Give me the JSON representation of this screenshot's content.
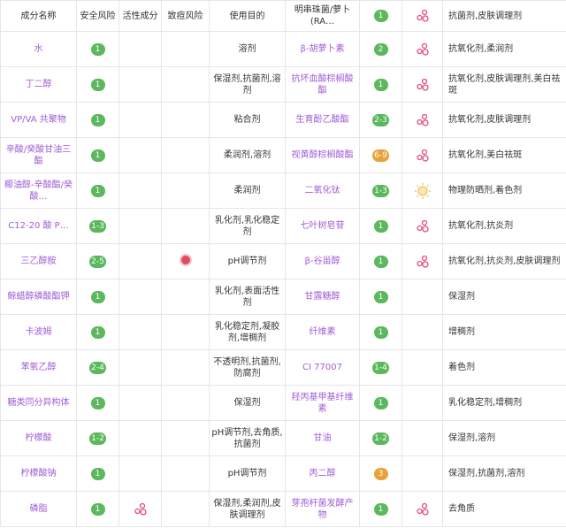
{
  "headers": [
    "成分名称",
    "安全风险",
    "活性成分",
    "致痘风险",
    "使用目的"
  ],
  "left": [
    {
      "name": "水",
      "risk": "1",
      "purpose": "溶剂"
    },
    {
      "name": "丁二醇",
      "risk": "1",
      "purpose": "保湿剂,抗菌剂,溶剂"
    },
    {
      "name": "VP/VA 共聚物",
      "risk": "1",
      "purpose": "粘合剂"
    },
    {
      "name": "辛酸/癸酸甘油三酯",
      "risk": "1",
      "purpose": "柔润剂,溶剂"
    },
    {
      "name": "椰油醇-辛酸酯/癸酸…",
      "risk": "1",
      "purpose": "柔润剂"
    },
    {
      "name": "C12-20 酸 P…",
      "risk": "1-3",
      "purpose": "乳化剂,乳化稳定剂"
    },
    {
      "name": "三乙醇胺",
      "risk": "2-5",
      "acne": true,
      "purpose": "pH调节剂"
    },
    {
      "name": "鲸蜡醇磷酸酯钾",
      "risk": "1",
      "purpose": "乳化剂,表面活性剂"
    },
    {
      "name": "卡波姆",
      "risk": "1",
      "purpose": "乳化稳定剂,凝胶剂,增稠剂"
    },
    {
      "name": "苯氧乙醇",
      "risk": "2-4",
      "purpose": "不透明剂,抗菌剂,防腐剂"
    },
    {
      "name": "糖类同分异构体",
      "risk": "1",
      "purpose": "保湿剂"
    },
    {
      "name": "柠檬酸",
      "risk": "1-2",
      "purpose": "pH调节剂,去角质,抗菌剂"
    },
    {
      "name": "柠檬酸钠",
      "risk": "1",
      "purpose": "pH调节剂"
    },
    {
      "name": "磷脂",
      "risk": "1",
      "active": true,
      "purpose": "保湿剂,柔润剂,皮肤调理剂"
    }
  ],
  "right": [
    {
      "name": "明串珠菌/萝卜(RA…",
      "risk": "1",
      "active": true,
      "purpose": "抗菌剂,皮肤调理剂"
    },
    {
      "name": "β-胡萝卜素",
      "risk": "2",
      "active": true,
      "purpose": "抗氧化剂,柔润剂"
    },
    {
      "name": "抗坏血酸棕榈酸酯",
      "risk": "1",
      "active": true,
      "purpose": "抗氧化剂,皮肤调理剂,美白祛斑"
    },
    {
      "name": "生育酚乙酸酯",
      "risk": "2-3",
      "active": true,
      "purpose": "抗氧化剂,皮肤调理剂"
    },
    {
      "name": "视黄醇棕榈酸酯",
      "risk": "6-9",
      "riskColor": "orange",
      "active": true,
      "purpose": "抗氧化剂,美白祛斑"
    },
    {
      "name": "二氧化钛",
      "risk": "1-3",
      "sun": true,
      "purpose": "物理防晒剂,着色剂"
    },
    {
      "name": "七叶树皂苷",
      "risk": "1",
      "active": true,
      "purpose": "抗氧化剂,抗炎剂"
    },
    {
      "name": "β-谷甾醇",
      "risk": "1",
      "active": true,
      "purpose": "抗氧化剂,抗炎剂,皮肤调理剂"
    },
    {
      "name": "甘露糖醇",
      "risk": "1",
      "purpose": "保湿剂"
    },
    {
      "name": "纤维素",
      "risk": "1",
      "purpose": "增稠剂"
    },
    {
      "name": "CI 77007",
      "risk": "1-4",
      "purpose": "着色剂"
    },
    {
      "name": "羟丙基甲基纤维素",
      "risk": "1",
      "purpose": "乳化稳定剂,增稠剂"
    },
    {
      "name": "甘油",
      "risk": "1-2",
      "purpose": "保湿剂,溶剂"
    },
    {
      "name": "丙二醇",
      "risk": "3",
      "riskColor": "orange",
      "purpose": "保湿剂,抗菌剂,溶剂"
    },
    {
      "name": "芽孢杆菌发酵产物",
      "risk": "1",
      "active": true,
      "purpose": "去角质"
    }
  ]
}
